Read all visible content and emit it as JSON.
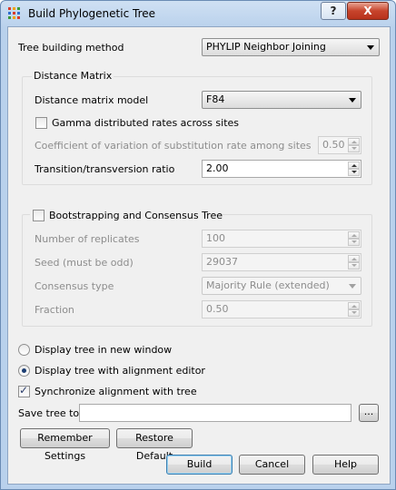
{
  "window": {
    "title": "Build Phylogenetic Tree",
    "help_label": "?",
    "close_label": "X"
  },
  "method": {
    "label": "Tree building method",
    "value": "PHYLIP Neighbor Joining"
  },
  "distance_matrix": {
    "legend": "Distance Matrix",
    "model_label": "Distance matrix model",
    "model_value": "F84",
    "gamma_label": "Gamma distributed rates across sites",
    "gamma_checked": false,
    "coef_label": "Coefficient of variation of substitution rate among sites",
    "coef_value": "0.50",
    "ratio_label": "Transition/transversion ratio",
    "ratio_value": "2.00"
  },
  "bootstrap": {
    "legend": "Bootstrapping and Consensus Tree",
    "checked": false,
    "replicates_label": "Number of replicates",
    "replicates_value": "100",
    "seed_label": "Seed (must be odd)",
    "seed_value": "29037",
    "consensus_label": "Consensus type",
    "consensus_value": "Majority Rule (extended)",
    "fraction_label": "Fraction",
    "fraction_value": "0.50"
  },
  "display": {
    "new_window_label": "Display tree in new window",
    "with_alignment_label": "Display tree with alignment editor",
    "selected": "with_alignment",
    "sync_label": "Synchronize alignment with tree",
    "sync_checked": true
  },
  "save": {
    "label": "Save tree to",
    "value": "",
    "browse_label": "..."
  },
  "buttons": {
    "remember": "Remember Settings",
    "restore": "Restore Default",
    "build": "Build",
    "cancel": "Cancel",
    "help": "Help"
  }
}
